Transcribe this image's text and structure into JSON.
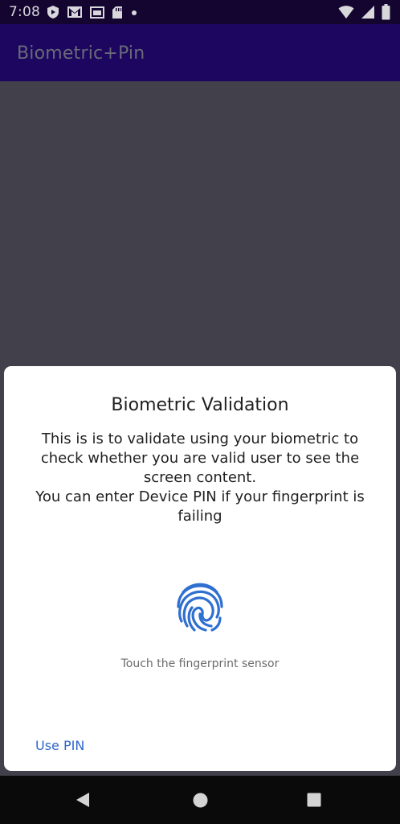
{
  "status_bar": {
    "time": "7:08",
    "left_icons": [
      "shield-play-icon",
      "gmail-icon",
      "sim-card-icon",
      "sd-card-icon",
      "dot-icon"
    ],
    "right_icons": [
      "wifi-icon",
      "signal-icon",
      "battery-icon"
    ]
  },
  "app_bar": {
    "title": "Biometric+Pin"
  },
  "dialog": {
    "title": "Biometric Validation",
    "description_lines": [
      "This is is to validate using your biometric to",
      "check whether you are valid user to see the",
      "screen content.",
      "You can enter Device PIN if your fingerprint is",
      "failing"
    ],
    "fingerprint_icon": "fingerprint-icon",
    "hint": "Touch the fingerprint sensor",
    "negative_button": "Use PIN"
  },
  "nav_bar": {
    "buttons": [
      "back-icon",
      "home-icon",
      "recents-icon"
    ]
  },
  "colors": {
    "accent": "#2f67c8",
    "app_bar": "#1c0660",
    "scrim": "#42414b"
  }
}
